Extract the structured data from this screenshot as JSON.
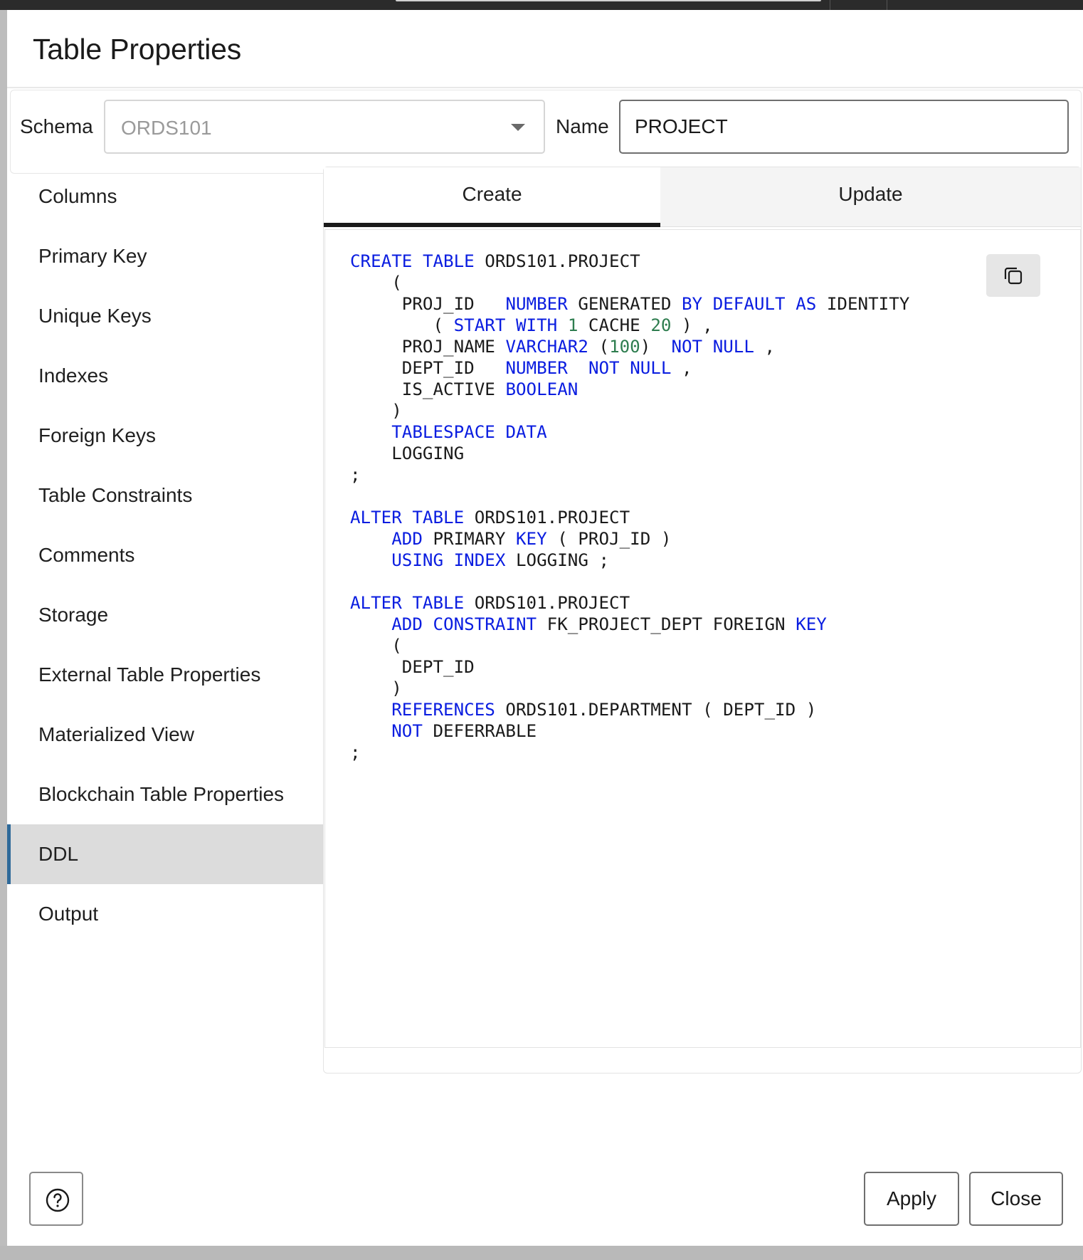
{
  "dialog": {
    "title": "Table Properties"
  },
  "schema": {
    "label": "Schema",
    "value": "ORDS101"
  },
  "name": {
    "label": "Name",
    "value": "PROJECT"
  },
  "sidebar": {
    "items": [
      {
        "label": "Columns",
        "active": false
      },
      {
        "label": "Primary Key",
        "active": false
      },
      {
        "label": "Unique Keys",
        "active": false
      },
      {
        "label": "Indexes",
        "active": false
      },
      {
        "label": "Foreign Keys",
        "active": false
      },
      {
        "label": "Table Constraints",
        "active": false
      },
      {
        "label": "Comments",
        "active": false
      },
      {
        "label": "Storage",
        "active": false
      },
      {
        "label": "External Table Properties",
        "active": false
      },
      {
        "label": "Materialized View",
        "active": false
      },
      {
        "label": "Blockchain Table Properties",
        "active": false
      },
      {
        "label": "DDL",
        "active": true
      },
      {
        "label": "Output",
        "active": false
      }
    ]
  },
  "tabs": {
    "create": "Create",
    "update": "Update",
    "selected": "Create"
  },
  "ddl": {
    "lines": [
      [
        [
          "kw",
          "CREATE"
        ],
        [
          "t",
          " "
        ],
        [
          "kw",
          "TABLE"
        ],
        [
          "t",
          " ORDS101.PROJECT"
        ]
      ],
      [
        [
          "t",
          "    ("
        ]
      ],
      [
        [
          "t",
          "     PROJ_ID   "
        ],
        [
          "kw",
          "NUMBER"
        ],
        [
          "t",
          " GENERATED "
        ],
        [
          "kw",
          "BY"
        ],
        [
          "t",
          " "
        ],
        [
          "kw",
          "DEFAULT"
        ],
        [
          "t",
          " "
        ],
        [
          "kw",
          "AS"
        ],
        [
          "t",
          " IDENTITY"
        ]
      ],
      [
        [
          "t",
          "        ( "
        ],
        [
          "kw",
          "START"
        ],
        [
          "t",
          " "
        ],
        [
          "kw",
          "WITH"
        ],
        [
          "t",
          " "
        ],
        [
          "num",
          "1"
        ],
        [
          "t",
          " CACHE "
        ],
        [
          "num",
          "20"
        ],
        [
          "t",
          " ) ,"
        ]
      ],
      [
        [
          "t",
          "     PROJ_NAME "
        ],
        [
          "kw",
          "VARCHAR2"
        ],
        [
          "t",
          " ("
        ],
        [
          "num",
          "100"
        ],
        [
          "t",
          ")  "
        ],
        [
          "kw",
          "NOT"
        ],
        [
          "t",
          " "
        ],
        [
          "kw",
          "NULL"
        ],
        [
          "t",
          " ,"
        ]
      ],
      [
        [
          "t",
          "     DEPT_ID   "
        ],
        [
          "kw",
          "NUMBER"
        ],
        [
          "t",
          "  "
        ],
        [
          "kw",
          "NOT"
        ],
        [
          "t",
          " "
        ],
        [
          "kw",
          "NULL"
        ],
        [
          "t",
          " ,"
        ]
      ],
      [
        [
          "t",
          "     IS_ACTIVE "
        ],
        [
          "kw",
          "BOOLEAN"
        ]
      ],
      [
        [
          "t",
          "    )"
        ]
      ],
      [
        [
          "t",
          "    "
        ],
        [
          "kw",
          "TABLESPACE"
        ],
        [
          "t",
          " "
        ],
        [
          "kw",
          "DATA"
        ]
      ],
      [
        [
          "t",
          "    LOGGING"
        ]
      ],
      [
        [
          "t",
          ";"
        ]
      ],
      [
        [
          "t",
          ""
        ]
      ],
      [
        [
          "kw",
          "ALTER"
        ],
        [
          "t",
          " "
        ],
        [
          "kw",
          "TABLE"
        ],
        [
          "t",
          " ORDS101.PROJECT"
        ]
      ],
      [
        [
          "t",
          "    "
        ],
        [
          "kw",
          "ADD"
        ],
        [
          "t",
          " PRIMARY "
        ],
        [
          "kw",
          "KEY"
        ],
        [
          "t",
          " ( PROJ_ID )"
        ]
      ],
      [
        [
          "t",
          "    "
        ],
        [
          "kw",
          "USING"
        ],
        [
          "t",
          " "
        ],
        [
          "kw",
          "INDEX"
        ],
        [
          "t",
          " LOGGING ;"
        ]
      ],
      [
        [
          "t",
          ""
        ]
      ],
      [
        [
          "kw",
          "ALTER"
        ],
        [
          "t",
          " "
        ],
        [
          "kw",
          "TABLE"
        ],
        [
          "t",
          " ORDS101.PROJECT"
        ]
      ],
      [
        [
          "t",
          "    "
        ],
        [
          "kw",
          "ADD"
        ],
        [
          "t",
          " "
        ],
        [
          "kw",
          "CONSTRAINT"
        ],
        [
          "t",
          " FK_PROJECT_DEPT FOREIGN "
        ],
        [
          "kw",
          "KEY"
        ]
      ],
      [
        [
          "t",
          "    ("
        ]
      ],
      [
        [
          "t",
          "     DEPT_ID"
        ]
      ],
      [
        [
          "t",
          "    )"
        ]
      ],
      [
        [
          "t",
          "    "
        ],
        [
          "kw",
          "REFERENCES"
        ],
        [
          "t",
          " ORDS101.DEPARTMENT ( DEPT_ID )"
        ]
      ],
      [
        [
          "t",
          "    "
        ],
        [
          "kw",
          "NOT"
        ],
        [
          "t",
          " DEFERRABLE"
        ]
      ],
      [
        [
          "t",
          ";"
        ]
      ]
    ]
  },
  "colors": {
    "keyword": "#0a1de0",
    "number": "#2e7d4f",
    "active_accent": "#2f6a9a"
  },
  "footer": {
    "help_icon": "help-circle-icon",
    "apply": "Apply",
    "close": "Close"
  },
  "toolbar": {
    "copy_icon": "copy-icon"
  }
}
